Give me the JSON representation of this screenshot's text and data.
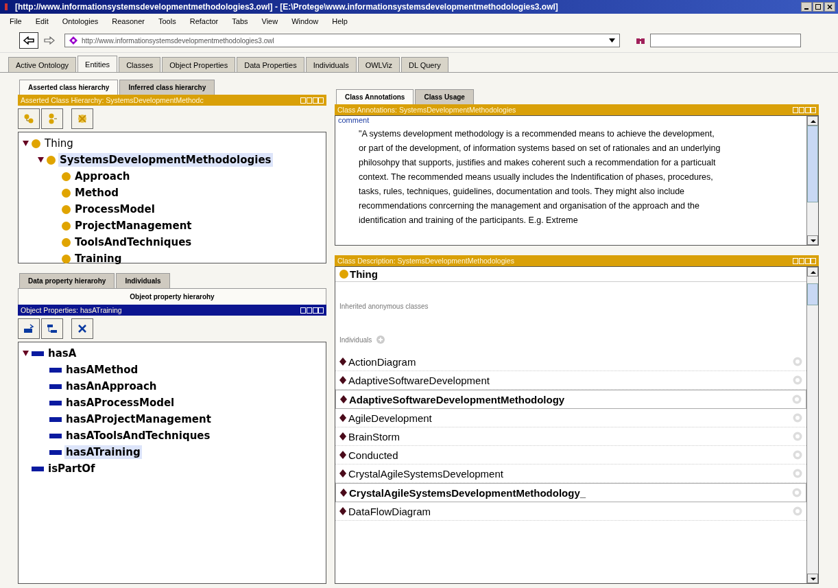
{
  "window": {
    "title": "[http://www.informationsystemsdevelopmentmethodologies3.owl] - [E:\\Protege\\www.informationsystemsdevelopmentmethodologies3.owl]"
  },
  "menu": [
    "File",
    "Edit",
    "Ontologies",
    "Reasoner",
    "Tools",
    "Refactor",
    "Tabs",
    "View",
    "Window",
    "Help"
  ],
  "address": {
    "value": "http://www.informationsystemsdevelopmentmethodologies3.owl"
  },
  "tabs": [
    {
      "label": "Active Ontology",
      "selected": false
    },
    {
      "label": "Entities",
      "selected": true
    },
    {
      "label": "Classes",
      "selected": false
    },
    {
      "label": "Object Properties",
      "selected": false
    },
    {
      "label": "Data Properties",
      "selected": false
    },
    {
      "label": "Individuals",
      "selected": false
    },
    {
      "label": "OWLViz",
      "selected": false
    },
    {
      "label": "DL Query",
      "selected": false
    }
  ],
  "class_panel": {
    "tabs": [
      {
        "label": "Asserted class hierarchy",
        "selected": true
      },
      {
        "label": "Inferred class hierarchy",
        "selected": false
      }
    ],
    "header": "Asserted Class Hierarchy: SystemsDevelopmentMethodc",
    "active": false,
    "tree": [
      {
        "label": "Thing",
        "bold": false,
        "selected": false,
        "expanded": true,
        "children": [
          {
            "label": "SystemsDevelopmentMethodologies",
            "bold": true,
            "selected": true,
            "expanded": true,
            "children": [
              {
                "label": "Approach",
                "bold": true,
                "selected": false
              },
              {
                "label": "Method",
                "bold": true,
                "selected": false
              },
              {
                "label": "ProcessModel",
                "bold": true,
                "selected": false
              },
              {
                "label": "ProjectManagement",
                "bold": true,
                "selected": false
              },
              {
                "label": "ToolsAndTechniques",
                "bold": true,
                "selected": false
              },
              {
                "label": "Training",
                "bold": true,
                "selected": false
              }
            ]
          }
        ]
      }
    ]
  },
  "property_panel": {
    "tabs": [
      {
        "label": "Data property hierarohy",
        "selected": false
      },
      {
        "label": "Individuals",
        "selected": false
      }
    ],
    "current_tab": {
      "label": "Objeot property hierarohy",
      "selected": true
    },
    "header": "Object Properties: hasATraining",
    "active": true,
    "tree": [
      {
        "label": "hasA",
        "bold": true,
        "selected": false,
        "expanded": true,
        "children": [
          {
            "label": "hasAMethod",
            "bold": true,
            "selected": false
          },
          {
            "label": "hasAnApproach",
            "bold": true,
            "selected": false
          },
          {
            "label": "hasAProcessModel",
            "bold": true,
            "selected": false
          },
          {
            "label": "hasAProjectManagement",
            "bold": true,
            "selected": false
          },
          {
            "label": "hasAToolsAndTechniques",
            "bold": true,
            "selected": false
          },
          {
            "label": "hasATraining",
            "bold": true,
            "selected": true
          }
        ]
      },
      {
        "label": "isPartOf",
        "bold": true,
        "selected": false
      }
    ]
  },
  "annotation_panel": {
    "tabs": [
      {
        "label": "Class Annotations",
        "selected": true
      },
      {
        "label": "Class Usage",
        "selected": false
      }
    ],
    "header": "Class Annotations: SystemsDevelopmentMethodologies",
    "active": false,
    "property": "comment",
    "text": "\"A systems development methodology is a recommended means to achieve the development, or part of the development, of information systems based on set of rationales and an underlying philosohpy that supports, justifies and makes coherent such a recommendation for a particualt context. The recommended means usually includes the Indentification of phases, procedures, tasks, rules, techniques, guidelines, documentation and tools. They might also include recommendations conrcerning the management and organisation of the approach and the identification and training of the participants. E.g. Extreme"
  },
  "description_panel": {
    "header": "Class Description: SystemsDevelopmentMethodologies",
    "active": false,
    "superclass": "Thing",
    "inherited_label": "Inherited anonymous classes",
    "individuals_label": "Individuals",
    "individuals": [
      {
        "name": "ActionDiagram",
        "bold": false
      },
      {
        "name": "AdaptiveSoftwareDevelopment",
        "bold": false
      },
      {
        "name": "AdaptiveSoftwareDevelopmentMethodology",
        "bold": true
      },
      {
        "name": "AgileDevelopment",
        "bold": false
      },
      {
        "name": "BrainStorm",
        "bold": false
      },
      {
        "name": "Conducted",
        "bold": false
      },
      {
        "name": "CrystalAgileSystemsDevelopment",
        "bold": false
      },
      {
        "name": "CrystalAgileSystemsDevelopmentMethodology_",
        "bold": true
      },
      {
        "name": "DataFlowDiagram",
        "bold": false
      }
    ]
  }
}
